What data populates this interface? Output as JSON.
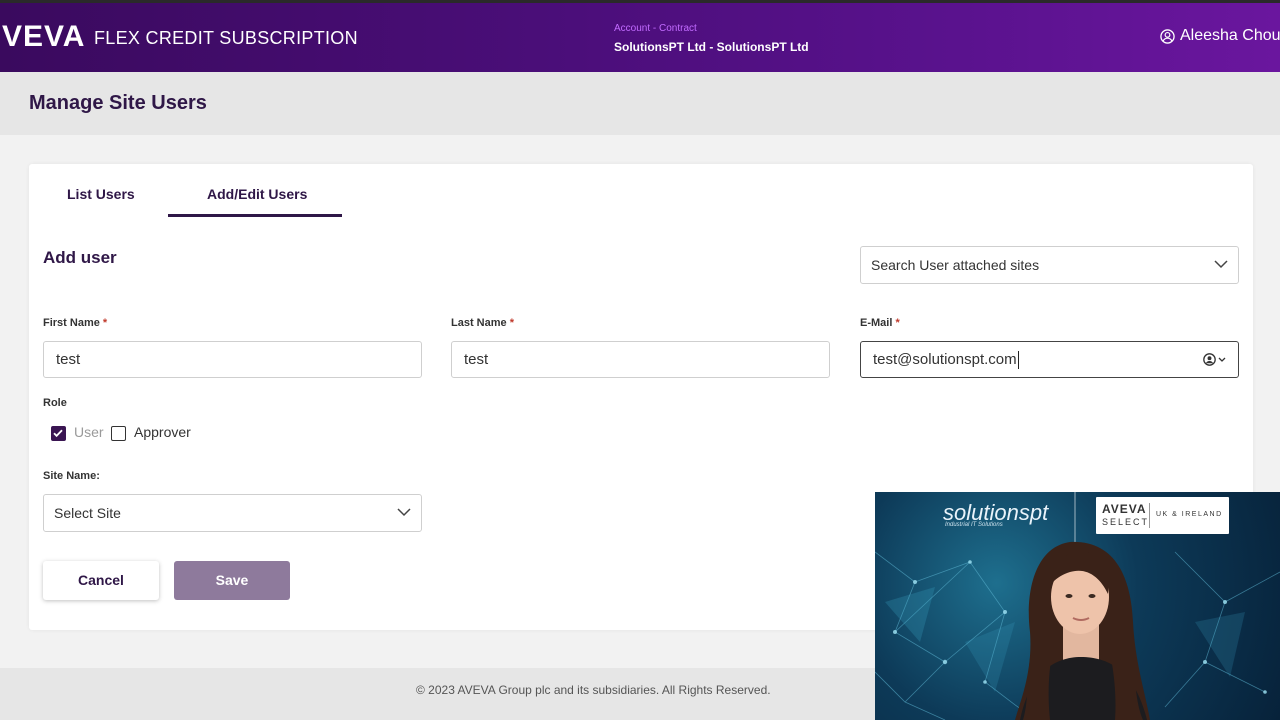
{
  "header": {
    "logo_text": "VEVA",
    "logo_mark": "",
    "app_title": "FLEX CREDIT SUBSCRIPTION",
    "account_crumb": "Account - Contract",
    "account_name": "SolutionsPT Ltd - SolutionsPT Ltd",
    "user_name": "Aleesha Chou",
    "user_icon": "user-circle-icon"
  },
  "page": {
    "title": "Manage Site Users"
  },
  "tabs": [
    {
      "label": "List Users",
      "active": false
    },
    {
      "label": "Add/Edit Users",
      "active": true
    }
  ],
  "form": {
    "section_title": "Add user",
    "site_search_placeholder": "Search User attached sites",
    "first_name": {
      "label": "First Name",
      "required": "*",
      "value": "test"
    },
    "last_name": {
      "label": "Last Name",
      "required": "*",
      "value": "test"
    },
    "email": {
      "label": "E-Mail",
      "required": "*",
      "value": "test@solutionspt.com"
    },
    "role": {
      "label": "Role",
      "options": [
        {
          "label": "User",
          "checked": true
        },
        {
          "label": "Approver",
          "checked": false
        }
      ]
    },
    "site_name": {
      "label": "Site Name:",
      "selected": "Select Site"
    },
    "cancel_label": "Cancel",
    "save_label": "Save"
  },
  "footer": {
    "copyright": "© 2023 AVEVA Group plc and its subsidiaries. All Rights Reserved."
  },
  "video_overlay": {
    "brand": "solutionspt",
    "brand_tagline": "Industrial IT Solutions",
    "partner_badge_line1": "AVEVA",
    "partner_badge_line2": "SELECT",
    "partner_badge_region": "UK & IRELAND"
  },
  "colors": {
    "header_gradient_start": "#3a0a5e",
    "header_gradient_end": "#6a169e",
    "accent": "#2f1747",
    "save_button": "#8e7a9c",
    "required": "#c0392b",
    "crumb": "#c26bff"
  }
}
